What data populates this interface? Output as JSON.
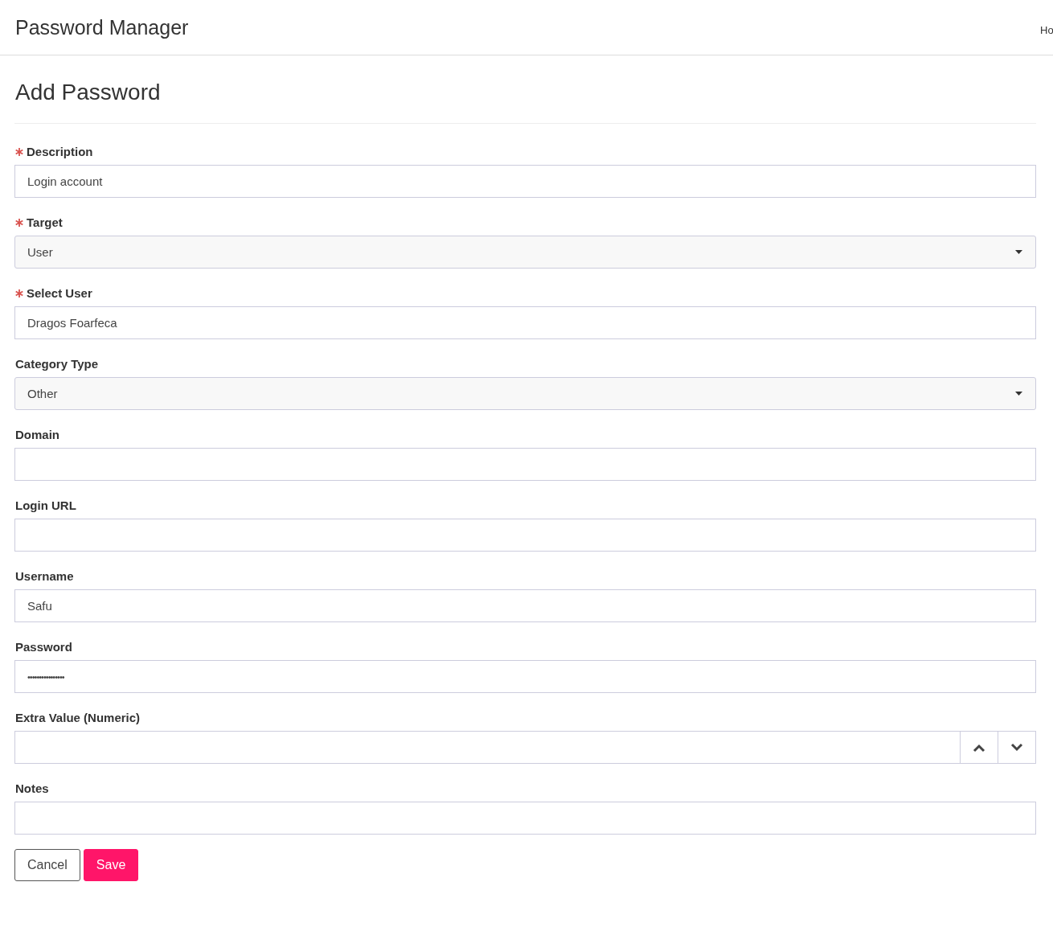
{
  "navbar": {
    "brand": "Password Manager",
    "nav_link": "Ho"
  },
  "page": {
    "title": "Add Password"
  },
  "fields": [
    {
      "label": "Description",
      "required": true,
      "kind": "text",
      "value": "Login account"
    },
    {
      "label": "Target",
      "required": true,
      "kind": "select",
      "value": "User"
    },
    {
      "label": "Select User",
      "required": true,
      "kind": "text",
      "value": "Dragos Foarfeca"
    },
    {
      "label": "Category Type",
      "required": false,
      "kind": "select",
      "value": "Other"
    },
    {
      "label": "Domain",
      "required": false,
      "kind": "text"
    },
    {
      "label": "Login URL",
      "required": false,
      "kind": "text"
    },
    {
      "label": "Username",
      "required": false,
      "kind": "text",
      "value": "Safu"
    },
    {
      "label": "Password",
      "required": false,
      "kind": "password",
      "value": "••••••••••••••••"
    },
    {
      "label": "Extra Value (Numeric)",
      "required": false,
      "kind": "number"
    },
    {
      "label": "Notes",
      "required": false,
      "kind": "text"
    }
  ],
  "buttons": [
    {
      "label": "Cancel",
      "kind": "secondary"
    },
    {
      "label": "Save",
      "kind": "primary"
    }
  ]
}
